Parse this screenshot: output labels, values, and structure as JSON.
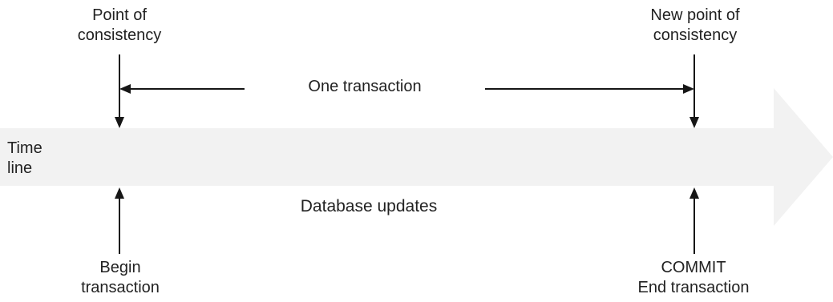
{
  "labels": {
    "begin_consistency": [
      "Point of",
      "consistency"
    ],
    "end_consistency": [
      "New point of",
      "consistency"
    ],
    "transaction_span": "One transaction",
    "timeline": [
      "Time",
      "line"
    ],
    "database_updates": "Database updates",
    "begin_transaction": [
      "Begin",
      "transaction"
    ],
    "end_transaction": [
      "COMMIT",
      "End transaction"
    ]
  },
  "colors": {
    "timeline_band": "#f2f2f2",
    "lines": "#161616",
    "text": "#222222"
  }
}
